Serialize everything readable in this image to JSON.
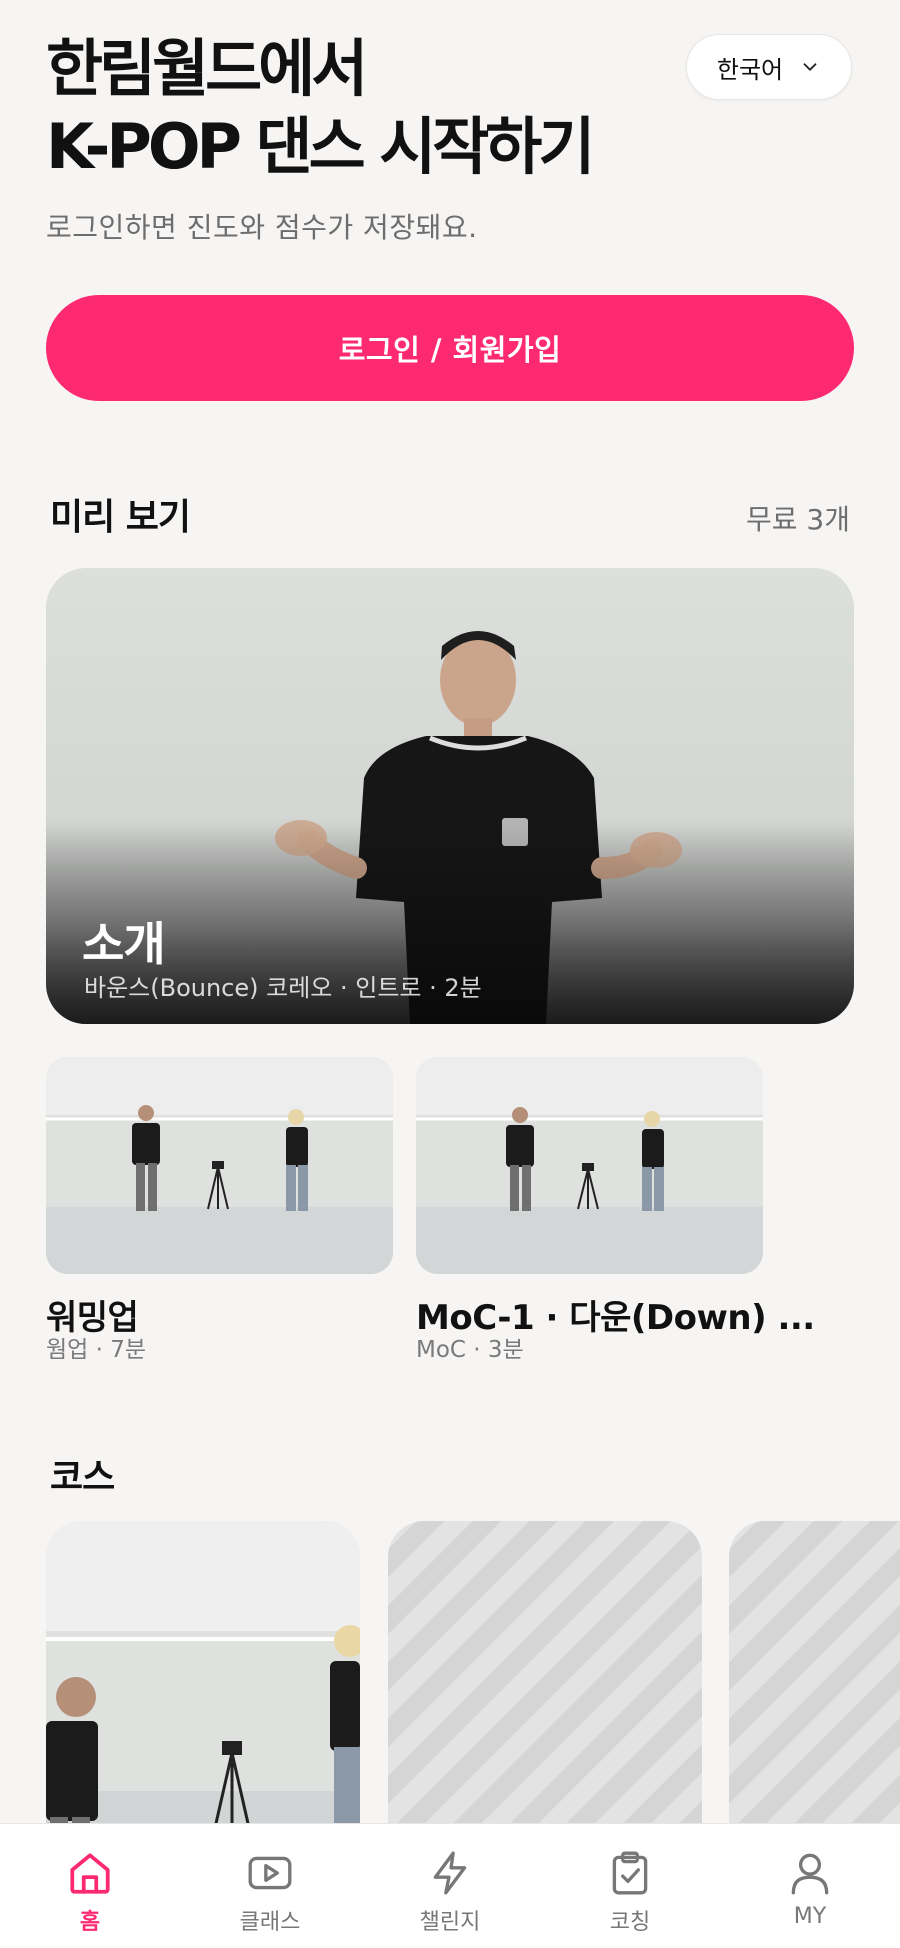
{
  "hero": {
    "title_line1": "한림월드에서",
    "title_line2": "K-POP 댄스 시작하기",
    "subtitle": "로그인하면 진도와 점수가 저장돼요."
  },
  "language": {
    "label": "한국어"
  },
  "login": {
    "label": "로그인 / 회원가입"
  },
  "preview": {
    "title": "미리 보기",
    "count": "무료 3개",
    "featured": {
      "title": "소개",
      "meta": "바운스(Bounce) 코레오 · 인트로 · 2분"
    },
    "items": [
      {
        "title": "워밍업",
        "meta": "웜업 · 7분"
      },
      {
        "title": "MoC-1 · 다운(Down) ...",
        "meta": "MoC · 3분"
      }
    ]
  },
  "courses": {
    "title": "코스"
  },
  "tabbar": {
    "items": [
      {
        "label": "홈",
        "icon": "home-icon",
        "active": true
      },
      {
        "label": "클래스",
        "icon": "play-icon",
        "active": false
      },
      {
        "label": "챌린지",
        "icon": "lightning-icon",
        "active": false
      },
      {
        "label": "코칭",
        "icon": "clipboard-check-icon",
        "active": false
      },
      {
        "label": "MY",
        "icon": "user-icon",
        "active": false
      }
    ]
  },
  "colors": {
    "accent": "#fe2a71",
    "background": "#f6f5f4",
    "muted": "#6d6d6d"
  }
}
